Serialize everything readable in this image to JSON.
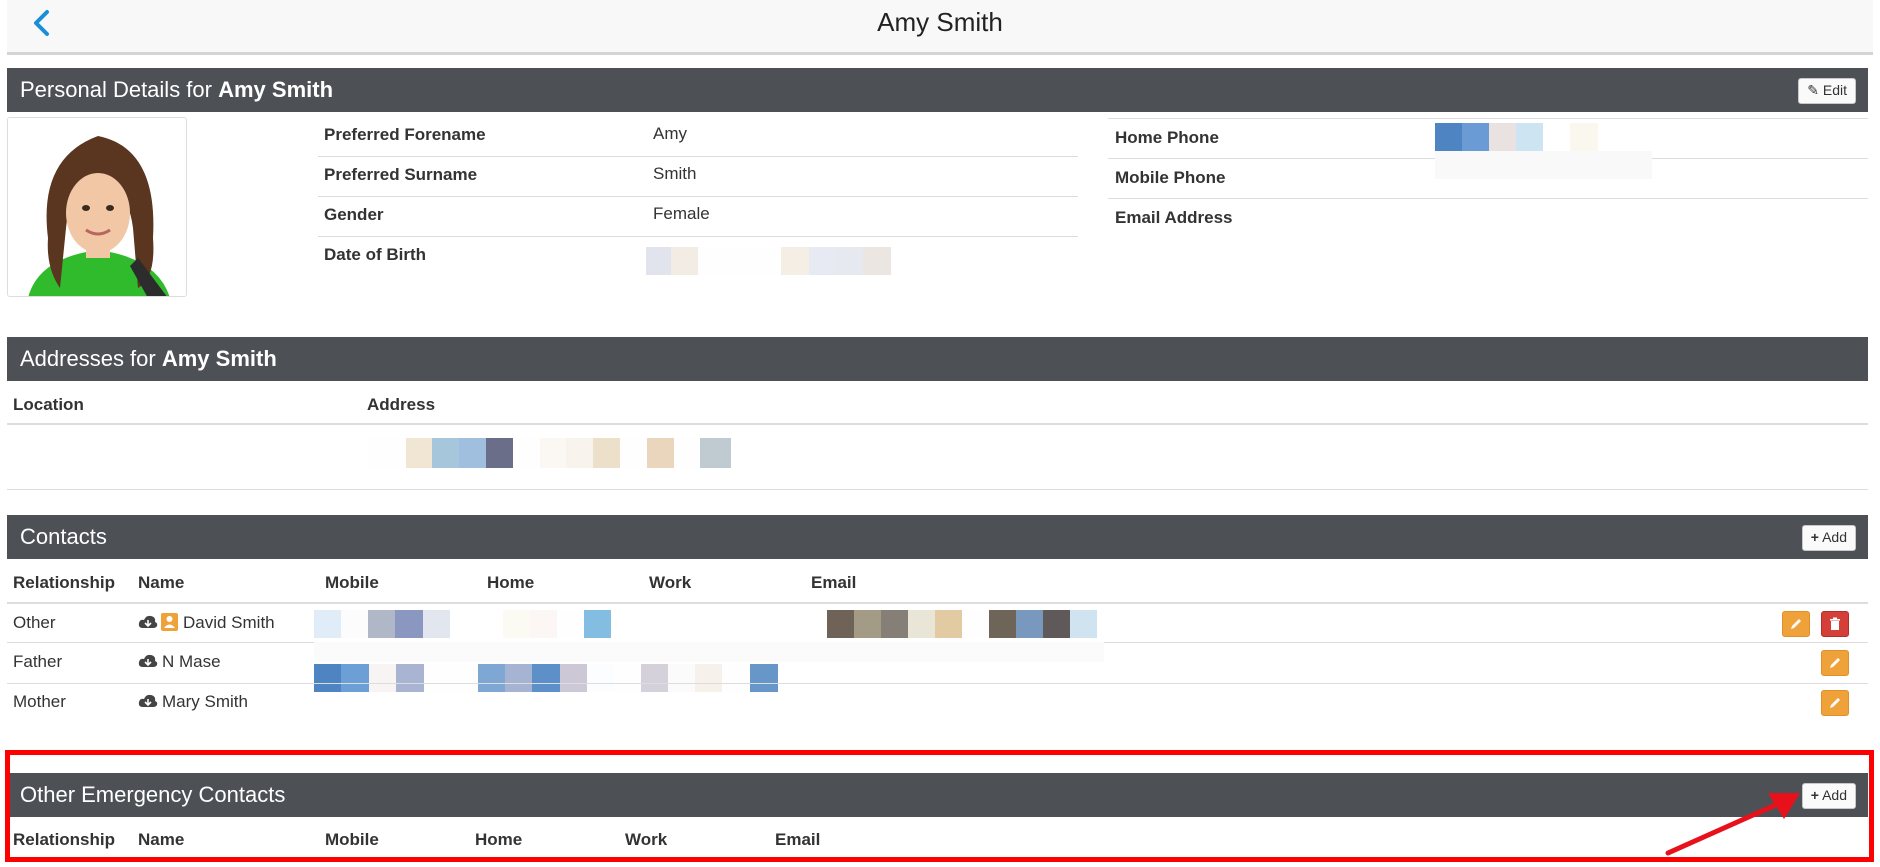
{
  "header": {
    "title": "Amy Smith"
  },
  "personal": {
    "heading_prefix": "Personal Details for",
    "heading_name": "Amy Smith",
    "edit_label": "Edit",
    "fields": [
      {
        "label": "Preferred Forename",
        "value": "Amy"
      },
      {
        "label": "Preferred Surname",
        "value": "Smith"
      },
      {
        "label": "Gender",
        "value": "Female"
      },
      {
        "label": "Date of Birth",
        "value": ""
      }
    ],
    "contact_fields": [
      {
        "label": "Home Phone",
        "value": ""
      },
      {
        "label": "Mobile Phone",
        "value": ""
      },
      {
        "label": "Email Address",
        "value": ""
      }
    ]
  },
  "addresses": {
    "heading_prefix": "Addresses for",
    "heading_name": "Amy Smith",
    "col_location": "Location",
    "col_address": "Address"
  },
  "contacts": {
    "heading": "Contacts",
    "add_label": "Add",
    "columns": [
      "Relationship",
      "Name",
      "Mobile",
      "Home",
      "Work",
      "Email"
    ],
    "rows": [
      {
        "relationship": "Other",
        "name": "David Smith"
      },
      {
        "relationship": "Father",
        "name": "N Mase"
      },
      {
        "relationship": "Mother",
        "name": "Mary Smith"
      }
    ]
  },
  "emergency": {
    "heading": "Other Emergency Contacts",
    "add_label": "Add",
    "columns": [
      "Relationship",
      "Name",
      "Mobile",
      "Home",
      "Work",
      "Email"
    ]
  },
  "colors": {
    "header_bg": "#4d5055",
    "accent": "#1a8fd6",
    "edit_btn": "#f0a23a",
    "delete_btn": "#d43f3a",
    "highlight": "#ff0000"
  }
}
